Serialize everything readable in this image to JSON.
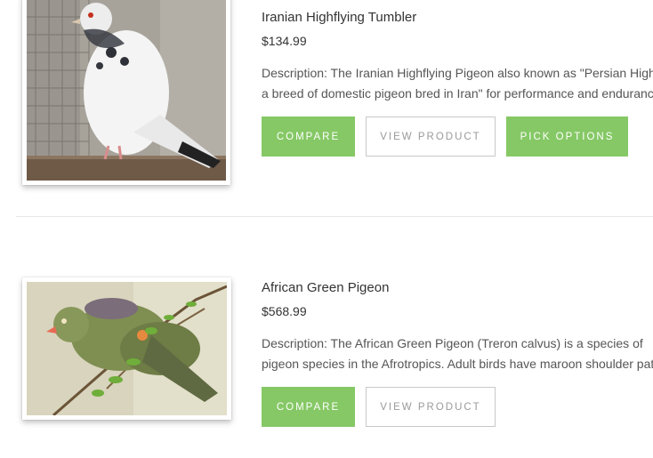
{
  "products": [
    {
      "name": "Iranian Highflying Tumbler",
      "price": "$134.99",
      "description_line1": "Description: The Iranian Highflying Pigeon also known as \"Persian Highflyer\" is",
      "description_line2": "a breed of domestic pigeon bred in Iran\" for performance and endurance flying.",
      "buttons": {
        "compare": "COMPARE",
        "view": "VIEW PRODUCT",
        "options": "PICK OPTIONS"
      },
      "image": "white and black tumbler pigeon on a ledge"
    },
    {
      "name": "African Green Pigeon",
      "price": "$568.99",
      "description_line1": "Description: The African Green Pigeon (Treron calvus) is a species of",
      "description_line2": "pigeon species in the Afrotropics. Adult birds have maroon shoulder patches",
      "buttons": {
        "compare": "COMPARE",
        "view": "VIEW PRODUCT"
      },
      "image": "green pigeon perched on a branch"
    }
  ],
  "colors": {
    "accent": "#85c865",
    "text": "#333333",
    "muted": "#9a9a9a"
  }
}
